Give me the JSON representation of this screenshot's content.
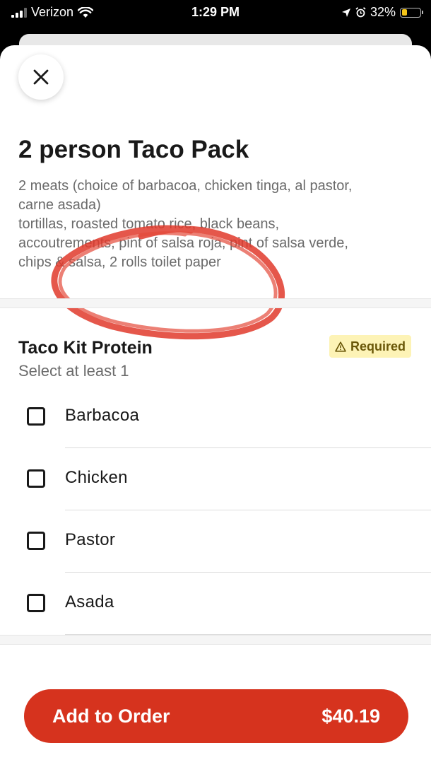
{
  "status_bar": {
    "carrier": "Verizon",
    "time": "1:29 PM",
    "battery": "32%",
    "battery_level": 0.32
  },
  "item": {
    "title": "2 person Taco Pack",
    "description_lines": [
      "2 meats (choice of barbacoa, chicken tinga, al pastor,",
      "carne asada)",
      "tortillas, roasted tomato rice, black beans,",
      "accoutrements, pint of salsa roja, pint of salsa verde,",
      "chips & salsa, 2 rolls toilet paper"
    ]
  },
  "section": {
    "title": "Taco Kit Protein",
    "subtitle": "Select at least 1",
    "required_label": "Required",
    "options": [
      {
        "label": "Barbacoa",
        "checked": false
      },
      {
        "label": "Chicken",
        "checked": false
      },
      {
        "label": "Pastor",
        "checked": false
      },
      {
        "label": "Asada",
        "checked": false
      }
    ]
  },
  "footer": {
    "button_label": "Add to Order",
    "price": "$40.19"
  },
  "colors": {
    "accent": "#d6331e",
    "required_bg": "#fdf3b6",
    "scribble": "#e0392b"
  },
  "icons": [
    "cellular-signal-icon",
    "wifi-icon",
    "location-arrow-icon",
    "alarm-icon",
    "battery-icon",
    "close-icon",
    "warning-icon"
  ]
}
